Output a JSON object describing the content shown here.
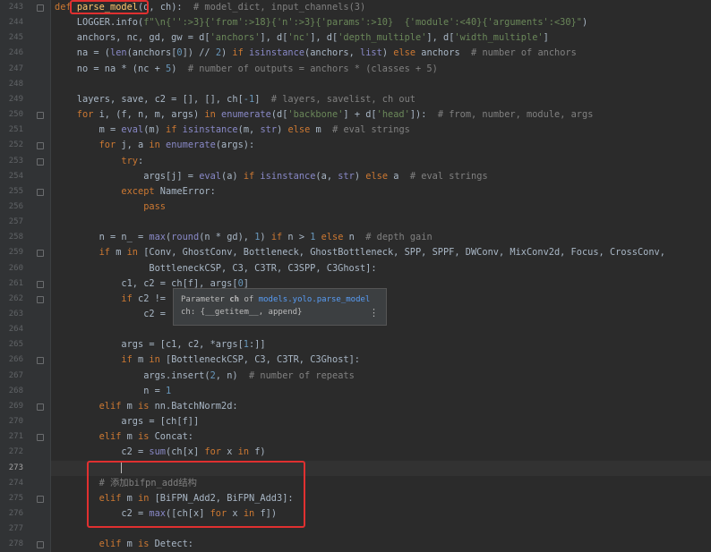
{
  "editor": {
    "lines": [
      {
        "no": "243",
        "tokens": [
          [
            "kw",
            "def "
          ],
          [
            "fn",
            "parse_model"
          ],
          [
            "",
            "(d, ch):  "
          ],
          [
            "cm",
            "# model_dict, input_channels(3)"
          ]
        ]
      },
      {
        "no": "244",
        "tokens": [
          [
            "",
            "    LOGGER.info("
          ],
          [
            "str",
            "f\"\\n{'':>3}{'from':>18}{'n':>3}{'params':>10}  {'module':<40}{'arguments':<30}\""
          ],
          [
            "",
            ")"
          ]
        ]
      },
      {
        "no": "245",
        "tokens": [
          [
            "",
            "    anchors, nc, gd, gw = d["
          ],
          [
            "str",
            "'anchors'"
          ],
          [
            "",
            "], d["
          ],
          [
            "str",
            "'nc'"
          ],
          [
            "",
            "], d["
          ],
          [
            "str",
            "'depth_multiple'"
          ],
          [
            "",
            "], d["
          ],
          [
            "str",
            "'width_multiple'"
          ],
          [
            "",
            "]"
          ]
        ]
      },
      {
        "no": "246",
        "tokens": [
          [
            "",
            "    na = ("
          ],
          [
            "bi",
            "len"
          ],
          [
            "",
            "(anchors["
          ],
          [
            "num",
            "0"
          ],
          [
            "",
            "]) // "
          ],
          [
            "num",
            "2"
          ],
          [
            "",
            ") "
          ],
          [
            "kw",
            "if "
          ],
          [
            "bi",
            "isinstance"
          ],
          [
            "",
            "(anchors, "
          ],
          [
            "bi",
            "list"
          ],
          [
            "",
            ") "
          ],
          [
            "kw",
            "else "
          ],
          [
            "",
            "anchors  "
          ],
          [
            "cm",
            "# number of anchors"
          ]
        ]
      },
      {
        "no": "247",
        "tokens": [
          [
            "",
            "    no = na * (nc + "
          ],
          [
            "num",
            "5"
          ],
          [
            "",
            ")  "
          ],
          [
            "cm",
            "# number of outputs = anchors * (classes + 5)"
          ]
        ]
      },
      {
        "no": "248",
        "tokens": [
          [
            "",
            ""
          ]
        ]
      },
      {
        "no": "249",
        "tokens": [
          [
            "",
            "    layers, save, c2 = [], [], ch["
          ],
          [
            "num",
            "-1"
          ],
          [
            "",
            "]  "
          ],
          [
            "cm",
            "# layers, savelist, ch out"
          ]
        ]
      },
      {
        "no": "250",
        "tokens": [
          [
            "kw",
            "    for "
          ],
          [
            "",
            "i, (f, n, m, args) "
          ],
          [
            "kw",
            "in "
          ],
          [
            "bi",
            "enumerate"
          ],
          [
            "",
            "(d["
          ],
          [
            "str",
            "'backbone'"
          ],
          [
            "",
            "] + d["
          ],
          [
            "str",
            "'head'"
          ],
          [
            "",
            "]):  "
          ],
          [
            "cm",
            "# from, number, module, args"
          ]
        ]
      },
      {
        "no": "251",
        "tokens": [
          [
            "",
            "        m = "
          ],
          [
            "bi",
            "eval"
          ],
          [
            "",
            "(m) "
          ],
          [
            "kw",
            "if "
          ],
          [
            "bi",
            "isinstance"
          ],
          [
            "",
            "(m, "
          ],
          [
            "bi",
            "str"
          ],
          [
            "",
            ") "
          ],
          [
            "kw",
            "else "
          ],
          [
            "",
            "m  "
          ],
          [
            "cm",
            "# eval strings"
          ]
        ]
      },
      {
        "no": "252",
        "tokens": [
          [
            "kw",
            "        for "
          ],
          [
            "",
            "j, a "
          ],
          [
            "kw",
            "in "
          ],
          [
            "bi",
            "enumerate"
          ],
          [
            "",
            "(args):"
          ]
        ]
      },
      {
        "no": "253",
        "tokens": [
          [
            "kw",
            "            try"
          ],
          [
            "",
            ":"
          ]
        ]
      },
      {
        "no": "254",
        "tokens": [
          [
            "",
            "                args[j] = "
          ],
          [
            "bi",
            "eval"
          ],
          [
            "",
            "(a) "
          ],
          [
            "kw",
            "if "
          ],
          [
            "bi",
            "isinstance"
          ],
          [
            "",
            "(a, "
          ],
          [
            "bi",
            "str"
          ],
          [
            "",
            ") "
          ],
          [
            "kw",
            "else "
          ],
          [
            "",
            "a  "
          ],
          [
            "cm",
            "# eval strings"
          ]
        ]
      },
      {
        "no": "255",
        "tokens": [
          [
            "kw",
            "            except "
          ],
          [
            "",
            "NameError:"
          ]
        ]
      },
      {
        "no": "256",
        "tokens": [
          [
            "kw",
            "                pass"
          ]
        ]
      },
      {
        "no": "257",
        "tokens": [
          [
            "",
            ""
          ]
        ]
      },
      {
        "no": "258",
        "tokens": [
          [
            "",
            "        n = n_ = "
          ],
          [
            "bi",
            "max"
          ],
          [
            "",
            "("
          ],
          [
            "bi",
            "round"
          ],
          [
            "",
            "(n * gd), "
          ],
          [
            "num",
            "1"
          ],
          [
            "",
            ") "
          ],
          [
            "kw",
            "if "
          ],
          [
            "",
            "n > "
          ],
          [
            "num",
            "1 "
          ],
          [
            "kw",
            "else "
          ],
          [
            "",
            "n  "
          ],
          [
            "cm",
            "# depth gain"
          ]
        ]
      },
      {
        "no": "259",
        "tokens": [
          [
            "kw",
            "        if "
          ],
          [
            "",
            "m "
          ],
          [
            "kw",
            "in "
          ],
          [
            "",
            "[Conv, GhostConv, Bottleneck, GhostBottleneck, SPP, SPPF, DWConv, MixConv2d, Focus, CrossConv,"
          ]
        ]
      },
      {
        "no": "260",
        "tokens": [
          [
            "",
            "                 BottleneckCSP, C3, C3TR, C3SPP, C3Ghost]:"
          ]
        ]
      },
      {
        "no": "261",
        "tokens": [
          [
            "",
            "            c1, c2 = ch[f], args["
          ],
          [
            "num",
            "0"
          ],
          [
            "",
            "]"
          ]
        ]
      },
      {
        "no": "262",
        "tokens": [
          [
            "kw",
            "            if "
          ],
          [
            "",
            "c2 !="
          ]
        ]
      },
      {
        "no": "263",
        "tokens": [
          [
            "",
            "                c2 ="
          ]
        ]
      },
      {
        "no": "264",
        "tokens": [
          [
            "",
            ""
          ]
        ]
      },
      {
        "no": "265",
        "tokens": [
          [
            "",
            "            args = [c1, c2, *args["
          ],
          [
            "num",
            "1"
          ],
          [
            "",
            ":]]"
          ]
        ]
      },
      {
        "no": "266",
        "tokens": [
          [
            "kw",
            "            if "
          ],
          [
            "",
            "m "
          ],
          [
            "kw",
            "in "
          ],
          [
            "",
            "[BottleneckCSP, C3, C3TR, C3Ghost]:"
          ]
        ]
      },
      {
        "no": "267",
        "tokens": [
          [
            "",
            "                args.insert("
          ],
          [
            "num",
            "2"
          ],
          [
            "",
            ", n)  "
          ],
          [
            "cm",
            "# number of repeats"
          ]
        ]
      },
      {
        "no": "268",
        "tokens": [
          [
            "",
            "                n = "
          ],
          [
            "num",
            "1"
          ]
        ]
      },
      {
        "no": "269",
        "tokens": [
          [
            "kw",
            "        elif "
          ],
          [
            "",
            "m "
          ],
          [
            "kw",
            "is "
          ],
          [
            "",
            "nn.BatchNorm2d:"
          ]
        ]
      },
      {
        "no": "270",
        "tokens": [
          [
            "",
            "            args = [ch[f]]"
          ]
        ]
      },
      {
        "no": "271",
        "tokens": [
          [
            "kw",
            "        elif "
          ],
          [
            "",
            "m "
          ],
          [
            "kw",
            "is "
          ],
          [
            "",
            "Concat:"
          ]
        ]
      },
      {
        "no": "272",
        "tokens": [
          [
            "",
            "            c2 = "
          ],
          [
            "bi",
            "sum"
          ],
          [
            "",
            "(ch[x] "
          ],
          [
            "kw",
            "for "
          ],
          [
            "",
            "x "
          ],
          [
            "kw",
            "in "
          ],
          [
            "",
            "f)"
          ]
        ]
      },
      {
        "no": "273",
        "tokens": [
          [
            "",
            "            "
          ],
          [
            "caret",
            ""
          ]
        ]
      },
      {
        "no": "274",
        "tokens": [
          [
            "cm",
            "        # 添加bifpn_add结构"
          ]
        ]
      },
      {
        "no": "275",
        "tokens": [
          [
            "kw",
            "        elif "
          ],
          [
            "",
            "m "
          ],
          [
            "kw",
            "in "
          ],
          [
            "",
            "[BiFPN_Add2, BiFPN_Add3]:"
          ]
        ]
      },
      {
        "no": "276",
        "tokens": [
          [
            "",
            "            c2 = "
          ],
          [
            "bi",
            "max"
          ],
          [
            "",
            "([ch[x] "
          ],
          [
            "kw",
            "for "
          ],
          [
            "",
            "x "
          ],
          [
            "kw",
            "in "
          ],
          [
            "",
            "f])"
          ]
        ]
      },
      {
        "no": "277",
        "tokens": [
          [
            "",
            ""
          ]
        ]
      },
      {
        "no": "278",
        "tokens": [
          [
            "kw",
            "        elif "
          ],
          [
            "",
            "m "
          ],
          [
            "kw",
            "is "
          ],
          [
            "",
            "Detect:"
          ]
        ]
      }
    ],
    "current_line": "273"
  },
  "tooltip": {
    "prefix": "Parameter ",
    "param": "ch",
    "mid": " of ",
    "link": "models.yolo.parse_model",
    "signature": "ch: {__getitem__, append}",
    "menu_icon": "⋮"
  },
  "colors": {
    "annotation_box": "#e03030",
    "background": "#2b2b2b",
    "keyword": "#cc7832",
    "string": "#6a8759"
  }
}
